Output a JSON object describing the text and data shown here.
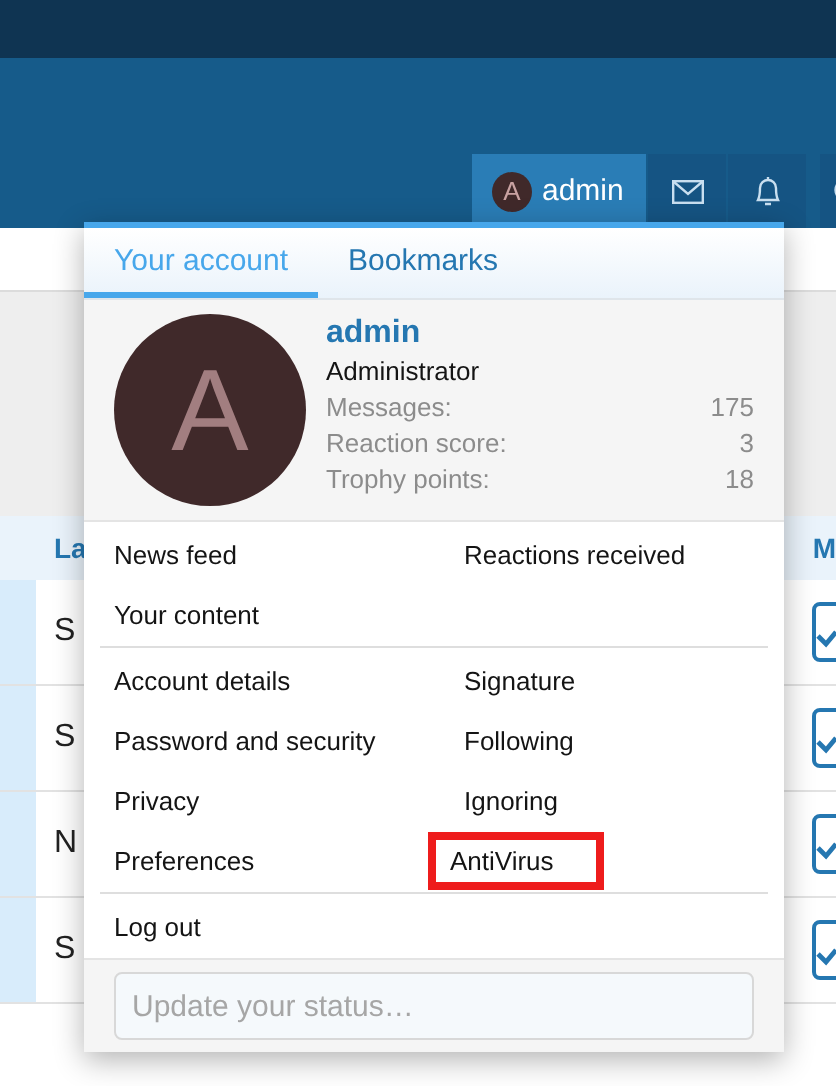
{
  "nav": {
    "user": {
      "avatar_letter": "A",
      "name": "admin",
      "selected": true
    }
  },
  "background_table": {
    "columns": [
      "La",
      "M"
    ],
    "rows": [
      {
        "cell": "S",
        "checked": true
      },
      {
        "cell": "S",
        "checked": true
      },
      {
        "cell": "N",
        "checked": true
      },
      {
        "cell": "S",
        "checked": true
      }
    ]
  },
  "account_menu": {
    "tabs": [
      {
        "label": "Your account",
        "selected": true
      },
      {
        "label": "Bookmarks",
        "selected": false
      }
    ],
    "profile": {
      "avatar_letter": "A",
      "name": "admin",
      "title": "Administrator",
      "stats": [
        {
          "label": "Messages:",
          "value": "175"
        },
        {
          "label": "Reaction score:",
          "value": "3"
        },
        {
          "label": "Trophy points:",
          "value": "18"
        }
      ]
    },
    "sections": [
      [
        {
          "label": "News feed",
          "highlighted": false
        },
        {
          "label": "Reactions received",
          "highlighted": false
        },
        {
          "label": "Your content",
          "highlighted": false
        }
      ],
      [
        {
          "label": "Account details",
          "highlighted": false
        },
        {
          "label": "Signature",
          "highlighted": false
        },
        {
          "label": "Password and security",
          "highlighted": false
        },
        {
          "label": "Following",
          "highlighted": false
        },
        {
          "label": "Privacy",
          "highlighted": false
        },
        {
          "label": "Ignoring",
          "highlighted": false
        },
        {
          "label": "Preferences",
          "highlighted": false
        },
        {
          "label": "AntiVirus",
          "highlighted": true
        }
      ],
      [
        {
          "label": "Log out",
          "highlighted": false
        }
      ]
    ],
    "status": {
      "placeholder": "Update your status…"
    }
  }
}
